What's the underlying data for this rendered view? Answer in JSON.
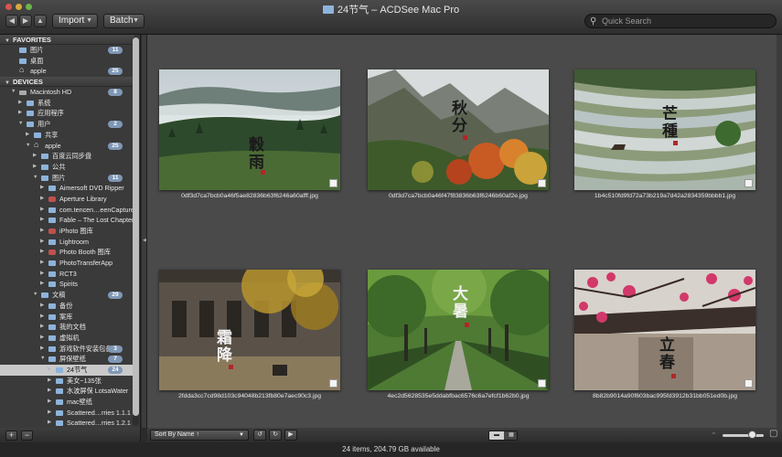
{
  "window": {
    "title": "24节气 – ACDSee Mac Pro",
    "nav_back": "◀",
    "nav_forward": "▶",
    "nav_up": "▲",
    "import_label": "Import",
    "batch_label": "Batch",
    "search_placeholder": "Quick Search"
  },
  "sidebar": {
    "favorites_header": "FAVORITES",
    "favorites": [
      {
        "label": "图片",
        "badge": "11"
      },
      {
        "label": "桌面",
        "badge": ""
      },
      {
        "label": "apple",
        "badge": "25"
      }
    ],
    "devices_header": "DEVICES",
    "tree": [
      {
        "label": "Macintosh HD",
        "badge": "8",
        "indent": 0,
        "open": true,
        "icon": "hd"
      },
      {
        "label": "系统",
        "badge": "",
        "indent": 1,
        "open": false,
        "icon": "folder"
      },
      {
        "label": "应用程序",
        "badge": "",
        "indent": 1,
        "open": false,
        "icon": "folder"
      },
      {
        "label": "用户",
        "badge": "2",
        "indent": 1,
        "open": true,
        "icon": "folder"
      },
      {
        "label": "共享",
        "badge": "",
        "indent": 2,
        "open": false,
        "icon": "folder"
      },
      {
        "label": "apple",
        "badge": "25",
        "indent": 2,
        "open": true,
        "icon": "home"
      },
      {
        "label": "百度云同步盘",
        "badge": "",
        "indent": 3,
        "open": false,
        "icon": "folder"
      },
      {
        "label": "公共",
        "badge": "",
        "indent": 3,
        "open": false,
        "icon": "folder"
      },
      {
        "label": "图片",
        "badge": "11",
        "indent": 3,
        "open": true,
        "icon": "folder"
      },
      {
        "label": "Aimersoft DVD Ripper",
        "badge": "",
        "indent": 4,
        "open": false,
        "icon": "folder"
      },
      {
        "label": "Aperture Library",
        "badge": "",
        "indent": 4,
        "open": false,
        "icon": "red"
      },
      {
        "label": "com.tencen…eenCapture",
        "badge": "",
        "indent": 4,
        "open": false,
        "icon": "folder"
      },
      {
        "label": "Fable – The Lost Chapters",
        "badge": "",
        "indent": 4,
        "open": false,
        "icon": "folder"
      },
      {
        "label": "iPhoto 图库",
        "badge": "",
        "indent": 4,
        "open": false,
        "icon": "red"
      },
      {
        "label": "Lightroom",
        "badge": "",
        "indent": 4,
        "open": false,
        "icon": "folder"
      },
      {
        "label": "Photo Booth 图库",
        "badge": "",
        "indent": 4,
        "open": false,
        "icon": "red"
      },
      {
        "label": "PhotoTransferApp",
        "badge": "",
        "indent": 4,
        "open": false,
        "icon": "folder"
      },
      {
        "label": "RCT3",
        "badge": "",
        "indent": 4,
        "open": false,
        "icon": "folder"
      },
      {
        "label": "Spirits",
        "badge": "",
        "indent": 4,
        "open": false,
        "icon": "folder"
      },
      {
        "label": "文稿",
        "badge": "29",
        "indent": 3,
        "open": true,
        "icon": "folder"
      },
      {
        "label": "备份",
        "badge": "",
        "indent": 4,
        "open": false,
        "icon": "folder"
      },
      {
        "label": "案库",
        "badge": "",
        "indent": 4,
        "open": false,
        "icon": "folder"
      },
      {
        "label": "我的文档",
        "badge": "",
        "indent": 4,
        "open": false,
        "icon": "folder"
      },
      {
        "label": "虚拟机",
        "badge": "",
        "indent": 4,
        "open": false,
        "icon": "folder"
      },
      {
        "label": "游戏软件安装包备份",
        "badge": "3",
        "indent": 4,
        "open": false,
        "icon": "folder"
      },
      {
        "label": "屏保壁纸",
        "badge": "7",
        "indent": 4,
        "open": true,
        "icon": "folder"
      },
      {
        "label": "24节气",
        "badge": "24",
        "indent": 5,
        "open": false,
        "icon": "folder",
        "selected": true
      },
      {
        "label": "美女~135张",
        "badge": "",
        "indent": 5,
        "open": false,
        "icon": "folder"
      },
      {
        "label": "水波屏保 LotsaWater",
        "badge": "",
        "indent": 5,
        "open": false,
        "icon": "folder"
      },
      {
        "label": "mac壁纸",
        "badge": "",
        "indent": 5,
        "open": false,
        "icon": "folder"
      },
      {
        "label": "Scattered…rries 1.1.1",
        "badge": "",
        "indent": 5,
        "open": false,
        "icon": "folder"
      },
      {
        "label": "Scattered…rries 1.2.1",
        "badge": "",
        "indent": 5,
        "open": false,
        "icon": "folder"
      }
    ],
    "add_label": "+",
    "remove_label": "−"
  },
  "grid": {
    "items": [
      {
        "filename": "0df3d7ca7bcb0a46f5ae82836b63f6246a60afff.jpg",
        "title": "穀雨"
      },
      {
        "filename": "0df3d7ca7bcb0a46f47f83836b63f6246b60af2e.jpg",
        "title": "秋分"
      },
      {
        "filename": "1b4c510fd9fd72a73b219a7d42a2834359bbbb1.jpg",
        "title": "芒種"
      },
      {
        "filename": "2fdda3cc7cd98d103c94048b213fb80e7aec90c3.jpg",
        "title": "霜降"
      },
      {
        "filename": "4ec2d5628535e5ddabfbac6576c6a7efcf1b62b0.jpg",
        "title": "大暑"
      },
      {
        "filename": "8b82b9014a90f603bac995fd3912b31bb051ed0b.jpg",
        "title": "立春"
      }
    ]
  },
  "bottombar": {
    "sort_label": "Sort By Name ↑",
    "zoom_level": 0.72
  },
  "status": {
    "text": "24 items, 204.79 GB available"
  }
}
